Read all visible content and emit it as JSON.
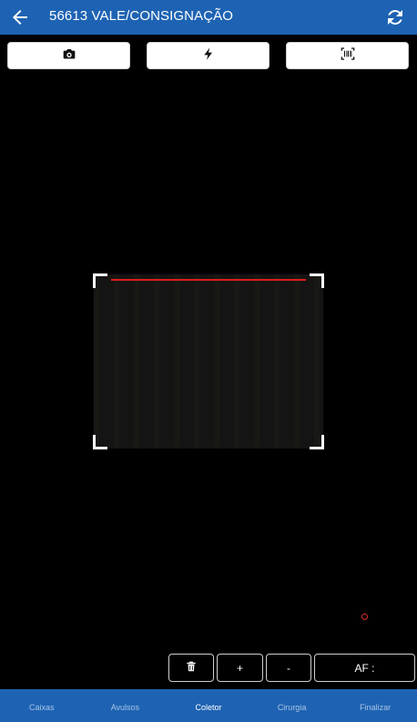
{
  "header": {
    "title": "56613 VALE/CONSIGNAÇÃO",
    "back_icon": "arrow-left-icon",
    "refresh_icon": "refresh-icon"
  },
  "camera_controls": [
    {
      "icon": "camera-icon"
    },
    {
      "icon": "flash-icon"
    },
    {
      "icon": "barcode-scan-icon"
    }
  ],
  "actions": {
    "delete_icon": "trash-icon",
    "plus_label": "+",
    "minus_label": "-",
    "af_label": "AF :"
  },
  "nav": {
    "items": [
      {
        "label": "Caixas",
        "active": false
      },
      {
        "label": "Avulsos",
        "active": false
      },
      {
        "label": "Coletor",
        "active": true
      },
      {
        "label": "Cirurgia",
        "active": false
      },
      {
        "label": "Finalizar",
        "active": false
      }
    ]
  },
  "colors": {
    "primary": "#1e63b3",
    "laser": "#e01b1b",
    "nav_inactive": "#a9c4e6",
    "nav_active": "#ffffff"
  }
}
